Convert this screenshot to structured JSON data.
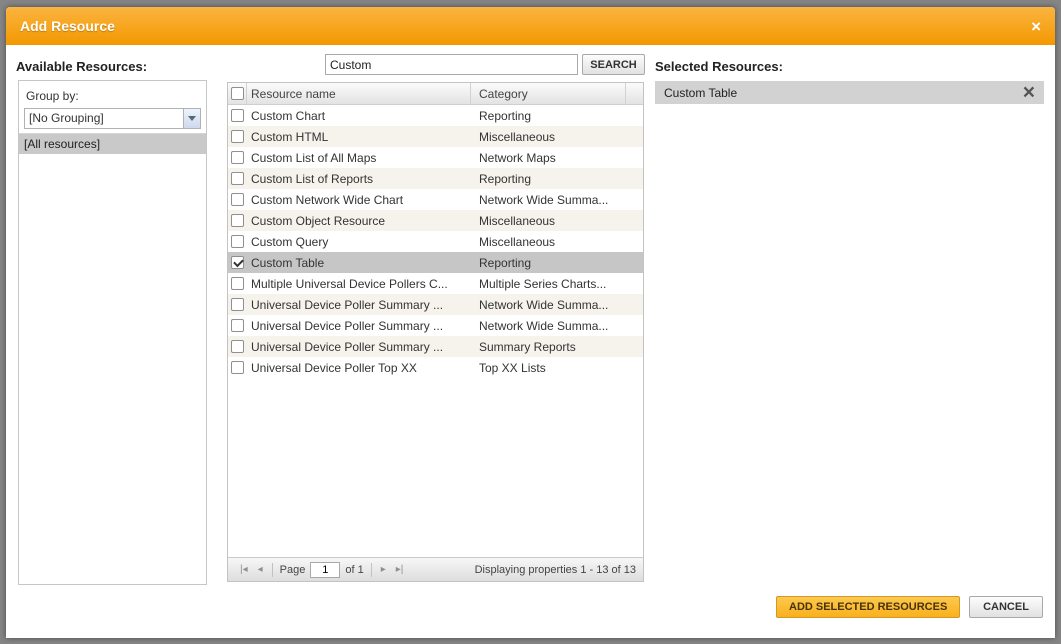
{
  "dialog": {
    "title": "Add Resource"
  },
  "icons": {
    "close": "×",
    "remove": "×",
    "first": "|◂",
    "prev": "◂",
    "next": "▸",
    "last": "▸|"
  },
  "available": {
    "label": "Available Resources:",
    "group_by_label": "Group by:",
    "grouping_value": "[No Grouping]",
    "all_resources_item": "[All resources]"
  },
  "search": {
    "value": "Custom",
    "button_label": "SEARCH"
  },
  "table": {
    "columns": [
      "Resource name",
      "Category"
    ],
    "rows": [
      {
        "name": "Custom Chart",
        "category": "Reporting",
        "checked": false,
        "selected": false
      },
      {
        "name": "Custom HTML",
        "category": "Miscellaneous",
        "checked": false,
        "selected": false
      },
      {
        "name": "Custom List of All Maps",
        "category": "Network Maps",
        "checked": false,
        "selected": false
      },
      {
        "name": "Custom List of Reports",
        "category": "Reporting",
        "checked": false,
        "selected": false
      },
      {
        "name": "Custom Network Wide Chart",
        "category": "Network Wide Summa...",
        "checked": false,
        "selected": false
      },
      {
        "name": "Custom Object Resource",
        "category": "Miscellaneous",
        "checked": false,
        "selected": false
      },
      {
        "name": "Custom Query",
        "category": "Miscellaneous",
        "checked": false,
        "selected": false
      },
      {
        "name": "Custom Table",
        "category": "Reporting",
        "checked": true,
        "selected": true
      },
      {
        "name": "Multiple Universal Device Pollers C...",
        "category": "Multiple Series Charts...",
        "checked": false,
        "selected": false
      },
      {
        "name": "Universal Device Poller Summary ...",
        "category": "Network Wide Summa...",
        "checked": false,
        "selected": false
      },
      {
        "name": "Universal Device Poller Summary ...",
        "category": "Network Wide Summa...",
        "checked": false,
        "selected": false
      },
      {
        "name": "Universal Device Poller Summary ...",
        "category": "Summary Reports",
        "checked": false,
        "selected": false
      },
      {
        "name": "Universal Device Poller Top XX",
        "category": "Top XX Lists",
        "checked": false,
        "selected": false
      }
    ]
  },
  "pagination": {
    "page_label": "Page",
    "page_value": "1",
    "of_label": "of 1",
    "status": "Displaying properties 1 - 13 of 13"
  },
  "selected": {
    "label": "Selected Resources:",
    "items": [
      "Custom Table"
    ]
  },
  "footer": {
    "add_button": "ADD SELECTED RESOURCES",
    "cancel_button": "CANCEL"
  },
  "colors": {
    "header_orange": "#f7a000",
    "accent_button": "#fbb725",
    "row_alt": "#f6f3ec",
    "row_selected": "#c6c6c6",
    "selected_item_bg": "#d2d2d2"
  }
}
